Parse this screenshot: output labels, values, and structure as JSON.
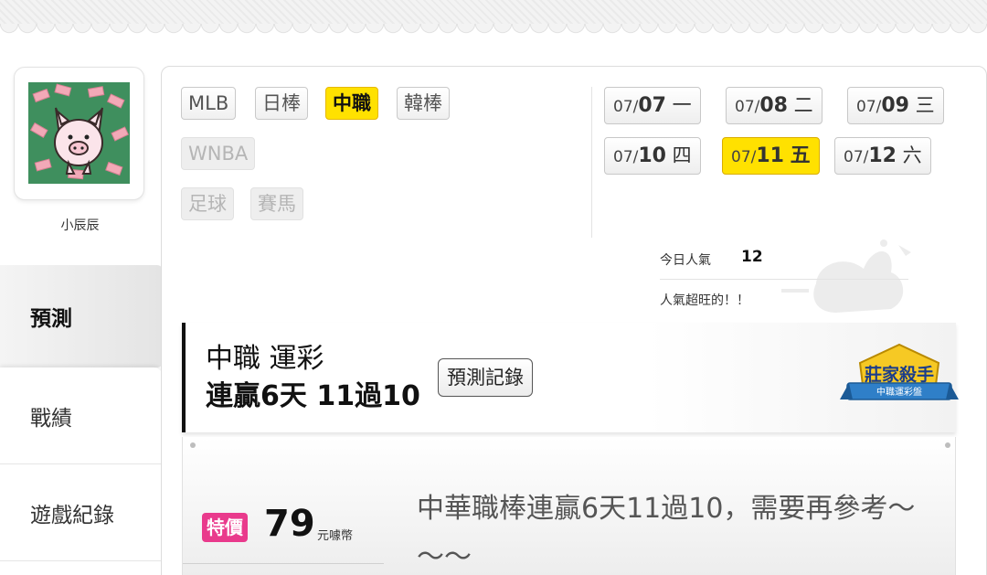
{
  "user": {
    "name": "小辰辰"
  },
  "sidebar": {
    "items": [
      {
        "label": "預測"
      },
      {
        "label": "戰績"
      },
      {
        "label": "遊戲紀錄"
      }
    ]
  },
  "leagues": [
    {
      "label": "MLB",
      "state": "normal"
    },
    {
      "label": "日棒",
      "state": "normal"
    },
    {
      "label": "中職",
      "state": "active"
    },
    {
      "label": "韓棒",
      "state": "normal"
    },
    {
      "label": "WNBA",
      "state": "disabled"
    },
    {
      "label": "足球",
      "state": "disabled"
    },
    {
      "label": "賽馬",
      "state": "disabled"
    }
  ],
  "dates": [
    {
      "md": "07/",
      "day": "07",
      "weekday": "一"
    },
    {
      "md": "07/",
      "day": "08",
      "weekday": "二"
    },
    {
      "md": "07/",
      "day": "09",
      "weekday": "三"
    },
    {
      "md": "07/",
      "day": "10",
      "weekday": "四"
    },
    {
      "md": "07/",
      "day": "11",
      "weekday": "五",
      "active": true
    },
    {
      "md": "07/",
      "day": "12",
      "weekday": "六"
    }
  ],
  "popularity": {
    "label": "今日人氣",
    "count": "12",
    "note": "人氣超旺的！！"
  },
  "title": {
    "line1": "中職 運彩",
    "line2": "連贏6天 11過10",
    "record_button": "預測記錄"
  },
  "badge": {
    "main": "莊家殺手",
    "sub": "中職運彩盤"
  },
  "offer": {
    "tag": "特價",
    "price": "79",
    "unit": "元噱幣",
    "description": "中華職棒連贏6天11過10，需要再參考～～～"
  },
  "colors": {
    "accent_yellow": "#ffe100",
    "tag_pink": "#e93a8c",
    "avatar_green": "#3f8f5e"
  }
}
